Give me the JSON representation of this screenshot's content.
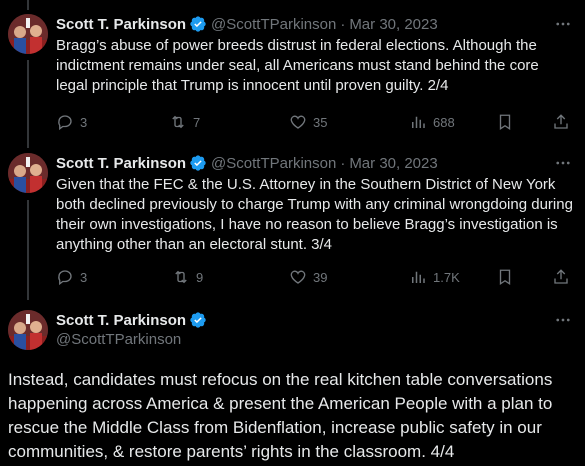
{
  "author": {
    "name": "Scott T. Parkinson",
    "handle": "@ScottTParkinson",
    "verified": true,
    "badge_color": "#1d9bf0"
  },
  "tweets": [
    {
      "date": "Mar 30, 2023",
      "separator": "·",
      "text": "Bragg’s abuse of power breeds distrust in federal elections. Although the indictment remains under seal, all Americans must stand behind the core legal principle that Trump is innocent until proven guilty. 2/4",
      "replies": "3",
      "retweets": "7",
      "likes": "35",
      "views": "688"
    },
    {
      "date": "Mar 30, 2023",
      "separator": "·",
      "text": "Given that the FEC & the U.S. Attorney in the Southern District of New York both declined previously to charge Trump with any criminal wrongdoing during their own investigations, I have no reason to believe Bragg’s investigation is anything other than an electoral stunt. 3/4",
      "replies": "3",
      "retweets": "9",
      "likes": "39",
      "views": "1.7K"
    },
    {
      "text": "Instead, candidates must refocus on the real kitchen table conversations happening across America & present the American People with a plan to rescue the Middle Class from Bidenflation, increase public safety in our communities, & restore parents’ rights in the classroom. 4/4"
    }
  ],
  "icons": {
    "reply": "reply-icon",
    "retweet": "retweet-icon",
    "like": "heart-icon",
    "views": "views-icon",
    "bookmark": "bookmark-icon",
    "share": "share-icon",
    "more": "more-icon"
  },
  "colors": {
    "background": "#000000",
    "text": "#e7e9ea",
    "muted": "#71767b",
    "accent": "#1d9bf0"
  }
}
